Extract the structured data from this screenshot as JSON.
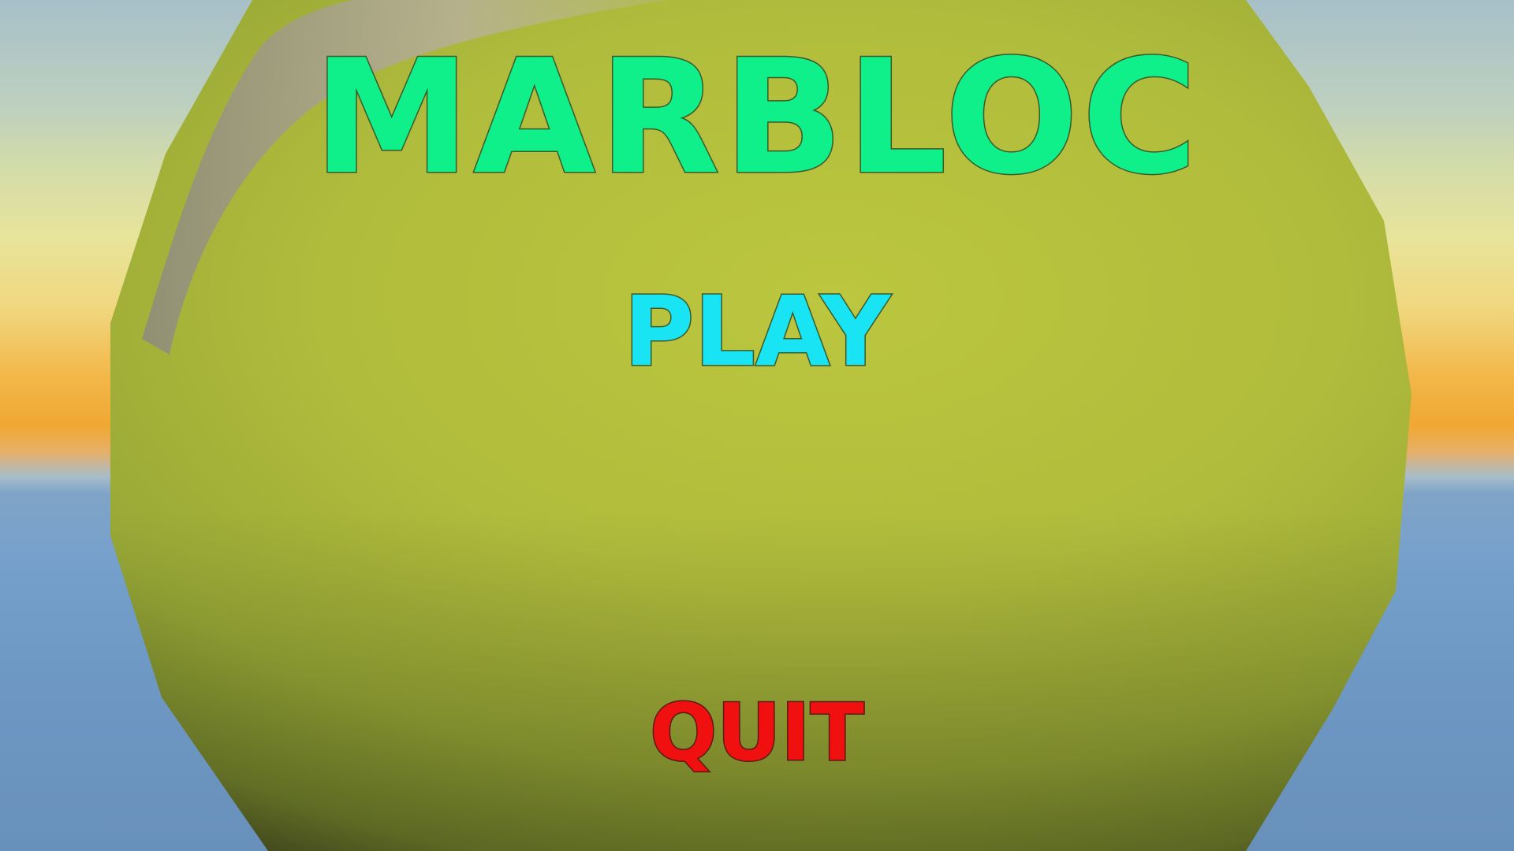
{
  "game": {
    "title": "MARBLOC"
  },
  "menu": {
    "play_label": "PLAY",
    "quit_label": "QUIT"
  },
  "colors": {
    "title": "#10f08a",
    "play": "#18e4f4",
    "quit": "#f01010",
    "marble": "#a8b83a",
    "sky_horizon": "#f0a832",
    "ground": "#6e98c4"
  }
}
